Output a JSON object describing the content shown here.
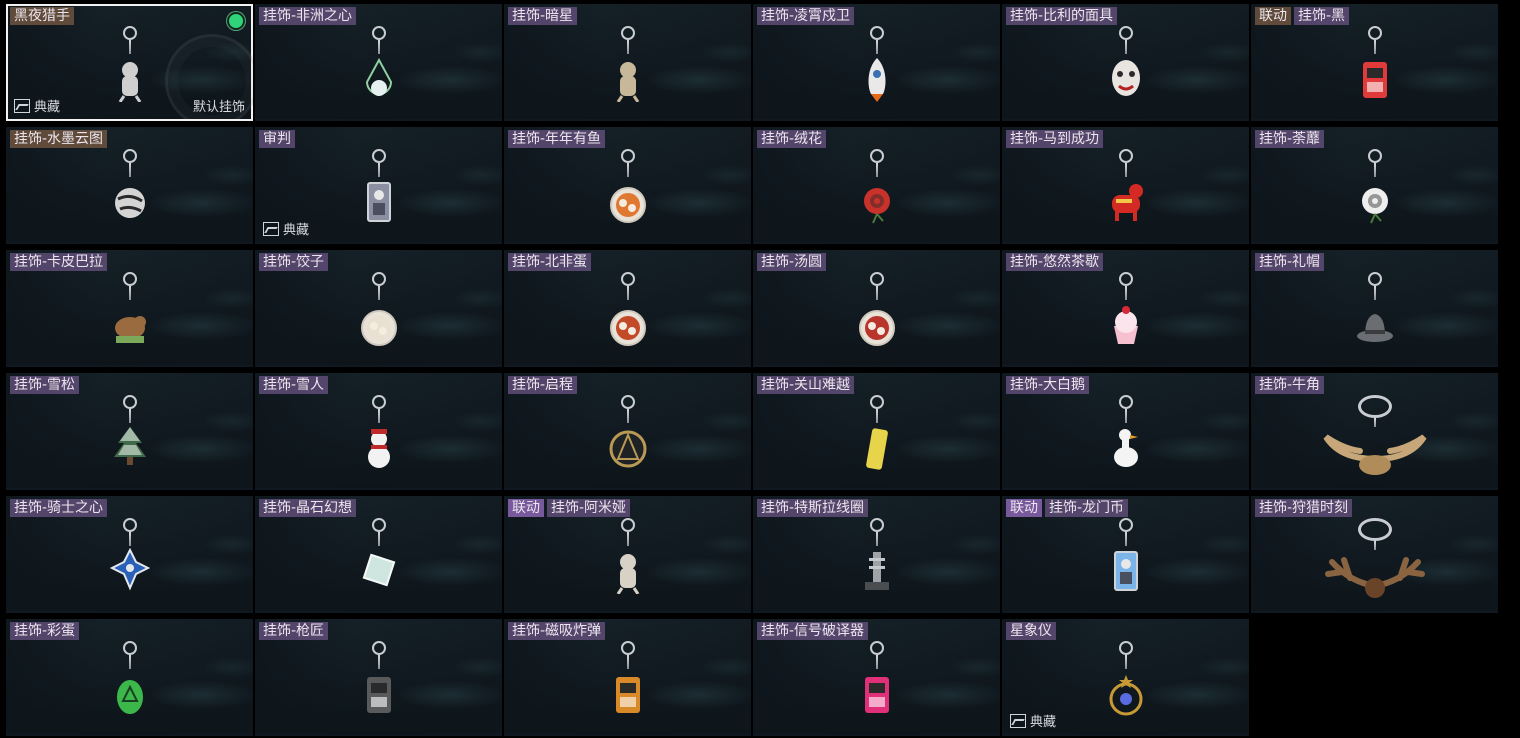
{
  "colors": {
    "selected_border": "#f2f2f2",
    "equipped_dot": "#2fd47a",
    "title_bg": "#644f7d",
    "collab_tag_bg": "#8460aa",
    "special_title_bg": "#6e543e"
  },
  "items": [
    {
      "name": "黑夜猎手",
      "selected": true,
      "equipped": true,
      "bottom_left": "典藏",
      "bottom_right": "默认挂饰",
      "style": "brown",
      "icon": "werewolf-charm-icon",
      "color": "#cfcfcf",
      "shape": "figure"
    },
    {
      "name": "挂饰-非洲之心",
      "icon": "heart-of-africa-charm-icon",
      "color": "#e6f0ee",
      "shape": "drop"
    },
    {
      "name": "挂饰-暗星",
      "icon": "dark-star-charm-icon",
      "color": "#c8b89a",
      "shape": "figure"
    },
    {
      "name": "挂饰-凌霄戍卫",
      "icon": "rocket-charm-icon",
      "color": "#e9e9ea",
      "shape": "rocket"
    },
    {
      "name": "挂饰-比利的面具",
      "icon": "billy-mask-charm-icon",
      "color": "#e8e4e0",
      "shape": "mask"
    },
    {
      "name": "挂饰-黑",
      "tag": "联动",
      "tag_style": "brown",
      "icon": "black-lighter-charm-icon",
      "color": "#e03a3a",
      "shape": "box"
    },
    {
      "name": "挂饰-水墨云图",
      "style": "brown",
      "icon": "ink-cloud-ball-charm-icon",
      "color": "#d4d4d4",
      "shape": "ball"
    },
    {
      "name": "审判",
      "bottom_left": "典藏",
      "icon": "judgement-card-charm-icon",
      "color": "#8a8fa2",
      "shape": "card"
    },
    {
      "name": "挂饰-年年有鱼",
      "icon": "fish-plate-charm-icon",
      "color": "#e07832",
      "shape": "plate"
    },
    {
      "name": "挂饰-绒花",
      "icon": "velvet-flower-charm-icon",
      "color": "#c8322a",
      "shape": "flower"
    },
    {
      "name": "挂饰-马到成功",
      "icon": "red-horse-charm-icon",
      "color": "#d42a24",
      "shape": "horse"
    },
    {
      "name": "挂饰-荼蘼",
      "icon": "white-flower-charm-icon",
      "color": "#eeeeee",
      "shape": "flower"
    },
    {
      "name": "挂饰-卡皮巴拉",
      "icon": "capybara-charm-icon",
      "color": "#9a6b3f",
      "shape": "animal"
    },
    {
      "name": "挂饰-饺子",
      "icon": "dumpling-plate-charm-icon",
      "color": "#e8e0d0",
      "shape": "plate"
    },
    {
      "name": "挂饰-北非蛋",
      "icon": "shakshuka-charm-icon",
      "color": "#c24a28",
      "shape": "plate"
    },
    {
      "name": "挂饰-汤圆",
      "icon": "tangyuan-bowl-charm-icon",
      "color": "#b8342c",
      "shape": "plate"
    },
    {
      "name": "挂饰-悠然茶歇",
      "icon": "cupcake-charm-icon",
      "color": "#f0a2b8",
      "shape": "cupcake"
    },
    {
      "name": "挂饰-礼帽",
      "icon": "top-hat-charm-icon",
      "color": "#6a6d72",
      "shape": "hat"
    },
    {
      "name": "挂饰-雪松",
      "icon": "snow-pine-charm-icon",
      "color": "#e4ece6",
      "shape": "tree"
    },
    {
      "name": "挂饰-雪人",
      "icon": "snowman-charm-icon",
      "color": "#f2f2f2",
      "shape": "snowman"
    },
    {
      "name": "挂饰-启程",
      "icon": "setting-off-medal-charm-icon",
      "color": "#b89a55",
      "shape": "medal"
    },
    {
      "name": "挂饰-关山难越",
      "icon": "yellow-tag-charm-icon",
      "color": "#e8d44a",
      "shape": "bar"
    },
    {
      "name": "挂饰-大白鹅",
      "icon": "white-goose-charm-icon",
      "color": "#f4f4f4",
      "shape": "goose"
    },
    {
      "name": "挂饰-牛角",
      "icon": "bull-horn-charm-icon",
      "color": "#c7a77a",
      "shape": "horns"
    },
    {
      "name": "挂饰-骑士之心",
      "icon": "knight-heart-cross-charm-icon",
      "color": "#2b60b8",
      "shape": "cross"
    },
    {
      "name": "挂饰-晶石幻想",
      "icon": "crystal-cube-charm-icon",
      "color": "#cfe6e0",
      "shape": "cube"
    },
    {
      "name": "挂饰-阿米娅",
      "tag": "联动",
      "tag_style": "violet",
      "icon": "amiya-charm-icon",
      "color": "#d8d2c6",
      "shape": "figure"
    },
    {
      "name": "挂饰-特斯拉线圈",
      "icon": "tesla-coil-charm-icon",
      "color": "#9ea3a8",
      "shape": "coil"
    },
    {
      "name": "挂饰-龙门币",
      "tag": "联动",
      "tag_style": "violet",
      "icon": "lungmen-coin-card-charm-icon",
      "color": "#7ab4e8",
      "shape": "card"
    },
    {
      "name": "挂饰-狩猎时刻",
      "icon": "antler-charm-icon",
      "color": "#8a6440",
      "shape": "antlers"
    },
    {
      "name": "挂饰-彩蛋",
      "icon": "easter-egg-charm-icon",
      "color": "#3cb84a",
      "shape": "egg"
    },
    {
      "name": "挂饰-枪匠",
      "icon": "gunsmith-case-charm-icon",
      "color": "#585a5c",
      "shape": "box"
    },
    {
      "name": "挂饰-磁吸炸弹",
      "icon": "magnet-bomb-charm-icon",
      "color": "#d88a28",
      "shape": "box"
    },
    {
      "name": "挂饰-信号破译器",
      "icon": "signal-decoder-charm-icon",
      "color": "#e0307a",
      "shape": "box"
    },
    {
      "name": "星象仪",
      "bottom_left": "典藏",
      "icon": "orrery-charm-icon",
      "color": "#c79a35",
      "shape": "orrery"
    }
  ]
}
